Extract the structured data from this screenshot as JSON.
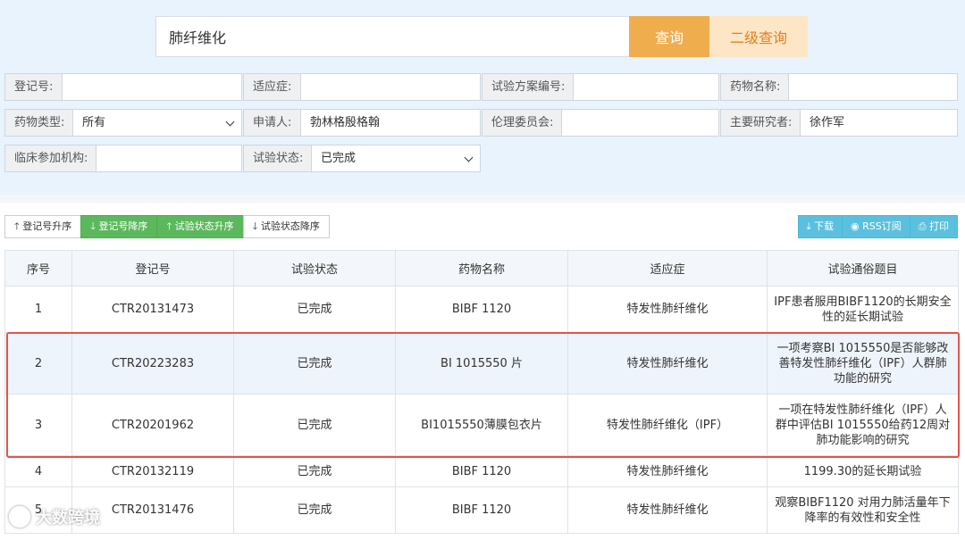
{
  "search": {
    "value": "肺纤维化",
    "query_label": "查询",
    "advanced_label": "二级查询"
  },
  "filters": {
    "reg_no": {
      "label": "登记号:",
      "value": ""
    },
    "indication": {
      "label": "适应症:",
      "value": ""
    },
    "protocol_no": {
      "label": "试验方案编号:",
      "value": ""
    },
    "drug_name": {
      "label": "药物名称:",
      "value": ""
    },
    "drug_type": {
      "label": "药物类型:",
      "value": "所有"
    },
    "applicant": {
      "label": "申请人:",
      "value": "勃林格殷格翰"
    },
    "ethics": {
      "label": "伦理委员会:",
      "value": ""
    },
    "pi": {
      "label": "主要研究者:",
      "value": "徐作军"
    },
    "site": {
      "label": "临床参加机构:",
      "value": ""
    },
    "status": {
      "label": "试验状态:",
      "value": "已完成"
    }
  },
  "sort": {
    "reg_asc": "登记号升序",
    "reg_desc": "登记号降序",
    "status_asc": "试验状态升序",
    "status_desc": "试验状态降序"
  },
  "actions": {
    "download": "下载",
    "rss": "RSS订阅",
    "print": "打印"
  },
  "table": {
    "headers": [
      "序号",
      "登记号",
      "试验状态",
      "药物名称",
      "适应症",
      "试验通俗题目"
    ],
    "rows": [
      {
        "no": "1",
        "reg": "CTR20131473",
        "status": "已完成",
        "drug": "BIBF 1120",
        "indication": "特发性肺纤维化",
        "title": "IPF患者服用BIBF1120的长期安全性的延长期试验"
      },
      {
        "no": "2",
        "reg": "CTR20223283",
        "status": "已完成",
        "drug": "BI 1015550 片",
        "indication": "特发性肺纤维化",
        "title": "一项考察BI 1015550是否能够改善特发性肺纤维化（IPF）人群肺功能的研究"
      },
      {
        "no": "3",
        "reg": "CTR20201962",
        "status": "已完成",
        "drug": "BI1015550薄膜包衣片",
        "indication": "特发性肺纤维化（IPF）",
        "title": "一项在特发性肺纤维化（IPF）人群中评估BI 1015550给药12周对肺功能影响的研究"
      },
      {
        "no": "4",
        "reg": "CTR20132119",
        "status": "已完成",
        "drug": "BIBF 1120",
        "indication": "特发性肺纤维化",
        "title": "1199.30的延长期试验"
      },
      {
        "no": "5",
        "reg": "CTR20131476",
        "status": "已完成",
        "drug": "BIBF 1120",
        "indication": "特发性肺纤维化",
        "title": "观察BIBF1120 对用力肺活量年下降率的有效性和安全性"
      }
    ]
  },
  "watermark": "大数跨境",
  "colors": {
    "query": "#f0ad4e",
    "advanced": "#fde6c5",
    "sort_active": "#5cb85c",
    "action": "#5bc0de",
    "highlight_border": "#e5534b"
  }
}
